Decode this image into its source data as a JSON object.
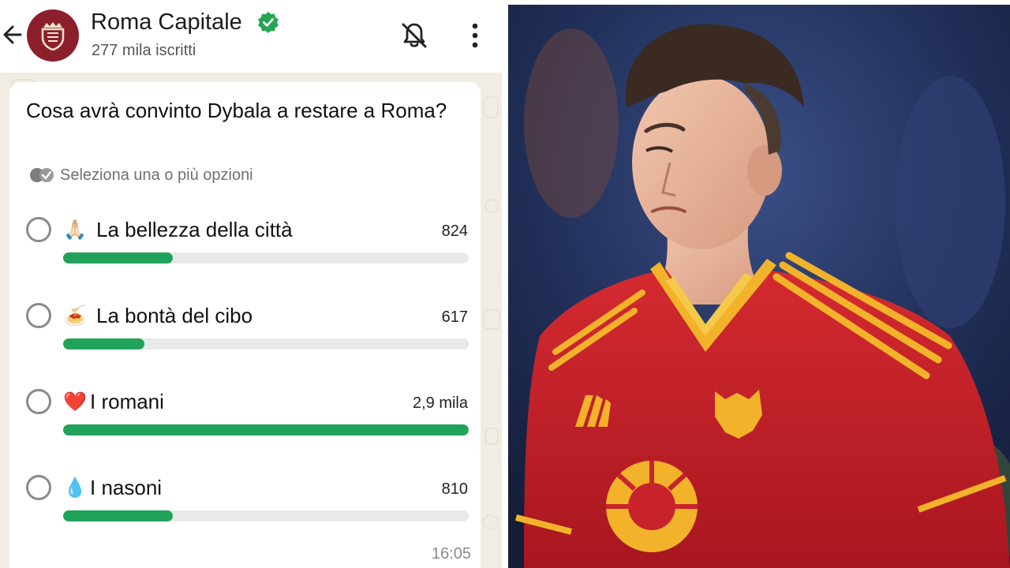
{
  "header": {
    "channel_name": "Roma Capitale",
    "subscribers": "277 mila iscritti",
    "icons": [
      "back-arrow-icon",
      "roma-crest-avatar",
      "verified-badge-icon",
      "notifications-off-icon",
      "more-vert-icon"
    ]
  },
  "poll": {
    "question": "Cosa avrà convinto Dybala a restare a Roma?",
    "hint": "Seleziona una o più opzioni",
    "options": [
      {
        "emoji": "🙏🏻",
        "label": "La bellezza della città",
        "count": "824",
        "fraction": 0.27
      },
      {
        "emoji": "🍝",
        "label": "La bontà del cibo",
        "count": "617",
        "fraction": 0.2
      },
      {
        "emoji": "❤️",
        "label": "I romani",
        "count": "2,9 mila",
        "fraction": 1.0
      },
      {
        "emoji": "💧",
        "label": "I nasoni",
        "count": "810",
        "fraction": 0.27
      }
    ],
    "time": "16:05"
  },
  "colors": {
    "accent_green": "#21a25a",
    "avatar_bg": "#8c1f2c",
    "verified_green": "#25a553",
    "chat_bg": "#f2ede4",
    "jersey_red": "#c8232c",
    "jersey_yellow": "#f2b32a"
  }
}
